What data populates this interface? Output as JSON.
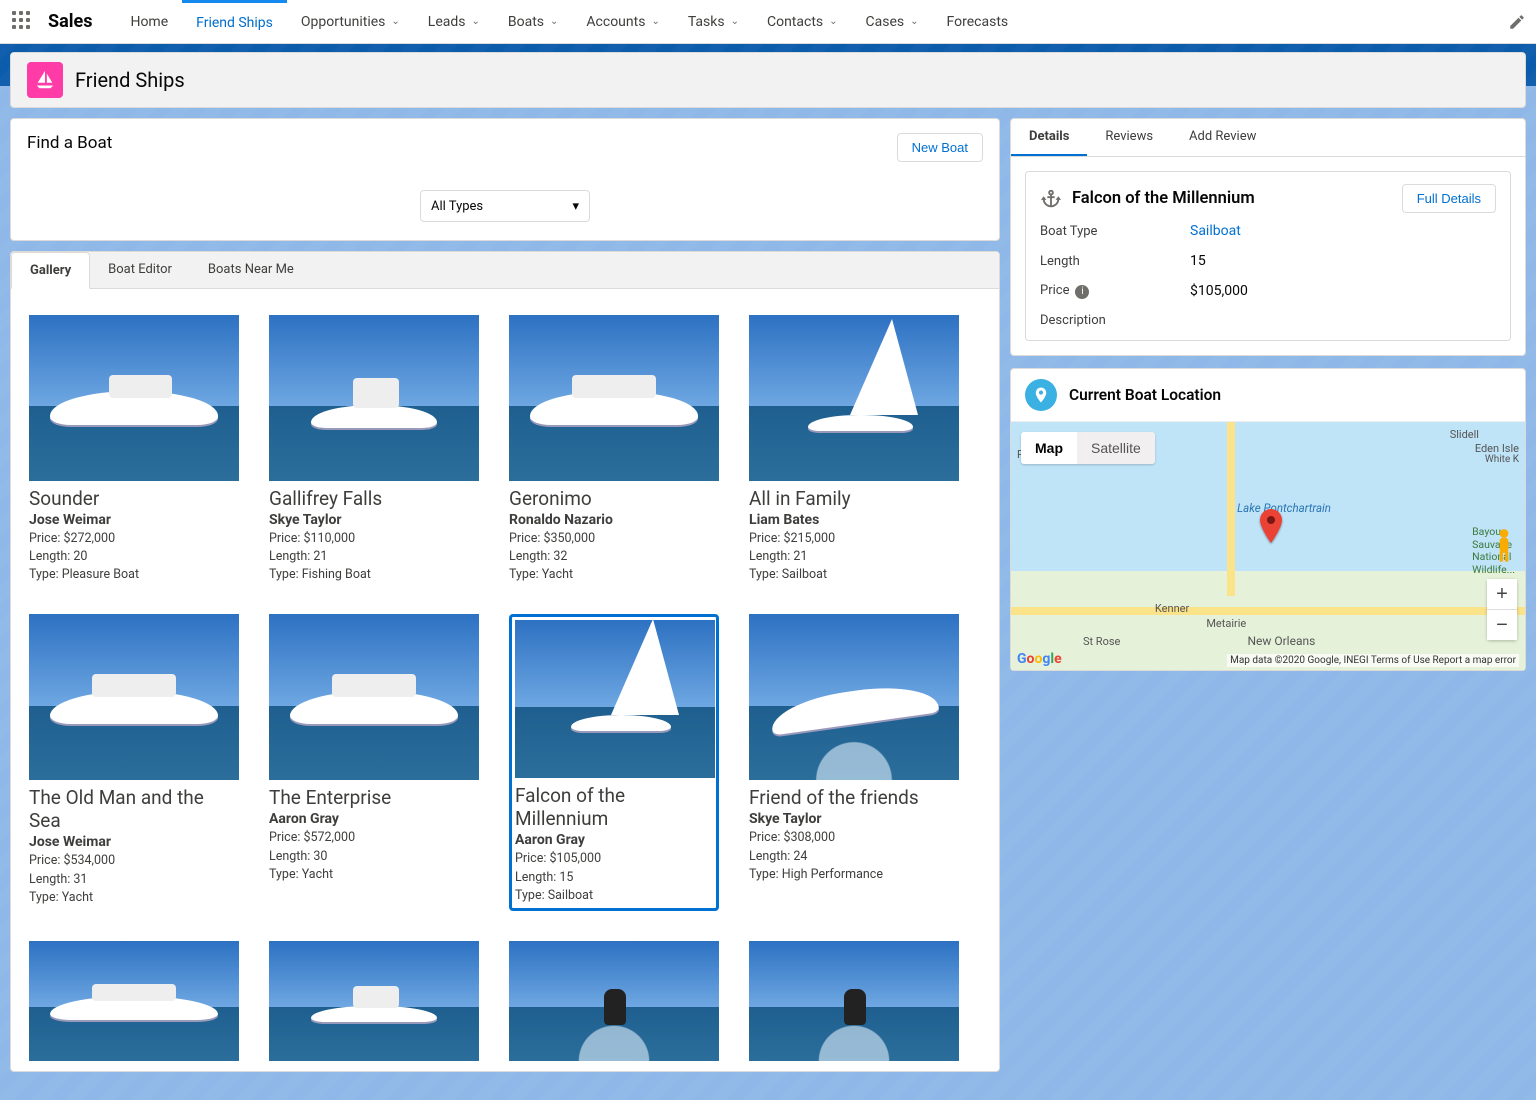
{
  "nav": {
    "appName": "Sales",
    "tabs": [
      {
        "label": "Home",
        "dropdown": false
      },
      {
        "label": "Friend Ships",
        "dropdown": false,
        "active": true
      },
      {
        "label": "Opportunities",
        "dropdown": true
      },
      {
        "label": "Leads",
        "dropdown": true
      },
      {
        "label": "Boats",
        "dropdown": true
      },
      {
        "label": "Accounts",
        "dropdown": true
      },
      {
        "label": "Tasks",
        "dropdown": true
      },
      {
        "label": "Contacts",
        "dropdown": true
      },
      {
        "label": "Cases",
        "dropdown": true
      },
      {
        "label": "Forecasts",
        "dropdown": false
      }
    ]
  },
  "pageTitle": "Friend Ships",
  "find": {
    "title": "Find a Boat",
    "newBoat": "New Boat",
    "typeSelected": "All Types"
  },
  "listTabs": [
    {
      "label": "Gallery",
      "active": true
    },
    {
      "label": "Boat Editor"
    },
    {
      "label": "Boats Near Me"
    }
  ],
  "priceLabel": "Price: ",
  "lengthLabel": "Length: ",
  "typeLabel": "Type: ",
  "boats": [
    {
      "name": "Sounder",
      "owner": "Jose Weimar",
      "price": "$272,000",
      "length": "20",
      "type": "Pleasure Boat",
      "art": "motor"
    },
    {
      "name": "Gallifrey Falls",
      "owner": "Skye Taylor",
      "price": "$110,000",
      "length": "21",
      "type": "Fishing Boat",
      "art": "fishing"
    },
    {
      "name": "Geronimo",
      "owner": "Ronaldo Nazario",
      "price": "$350,000",
      "length": "32",
      "type": "Yacht",
      "art": "yacht"
    },
    {
      "name": "All in Family",
      "owner": "Liam Bates",
      "price": "$215,000",
      "length": "21",
      "type": "Sailboat",
      "art": "sail"
    },
    {
      "name": "The Old Man and the Sea",
      "owner": "Jose Weimar",
      "price": "$534,000",
      "length": "31",
      "type": "Yacht",
      "art": "yacht"
    },
    {
      "name": "The Enterprise",
      "owner": "Aaron Gray",
      "price": "$572,000",
      "length": "30",
      "type": "Yacht",
      "art": "yacht"
    },
    {
      "name": "Falcon of the Millennium",
      "owner": "Aaron Gray",
      "price": "$105,000",
      "length": "15",
      "type": "Sailboat",
      "art": "sail",
      "selected": true
    },
    {
      "name": "Friend of the friends",
      "owner": "Skye Taylor",
      "price": "$308,000",
      "length": "24",
      "type": "High Performance",
      "art": "speed"
    },
    {
      "name": "",
      "owner": "",
      "price": "",
      "length": "",
      "type": "",
      "art": "yacht",
      "partial": true
    },
    {
      "name": "",
      "owner": "",
      "price": "",
      "length": "",
      "type": "",
      "art": "fishing",
      "partial": true
    },
    {
      "name": "",
      "owner": "",
      "price": "",
      "length": "",
      "type": "",
      "art": "jet",
      "partial": true
    },
    {
      "name": "",
      "owner": "",
      "price": "",
      "length": "",
      "type": "",
      "art": "jet",
      "partial": true
    }
  ],
  "detailTabs": [
    {
      "label": "Details",
      "active": true
    },
    {
      "label": "Reviews"
    },
    {
      "label": "Add Review"
    }
  ],
  "detail": {
    "title": "Falcon of the Millennium",
    "fullDetails": "Full Details",
    "fields": {
      "boatTypeLabel": "Boat Type",
      "boatType": "Sailboat",
      "lengthLabel": "Length",
      "length": "15",
      "priceLabel": "Price",
      "price": "$105,000",
      "descriptionLabel": "Description"
    }
  },
  "map": {
    "title": "Current Boat Location",
    "mapBtn": "Map",
    "satBtn": "Satellite",
    "lake": "Lake Pontchartrain",
    "cities": {
      "slidell": "Slidell",
      "kenner": "Kenner",
      "metairie": "Metairie",
      "neworleans": "New Orleans",
      "ruddock": "Ruddock",
      "stRose": "St Rose",
      "eden": "Eden Isle",
      "whitek": "White K"
    },
    "wildlife": "Bayou\nSauvage\nNational\nWildlife...",
    "attr": "Map data ©2020 Google, INEGI   Terms of Use   Report a map error"
  }
}
